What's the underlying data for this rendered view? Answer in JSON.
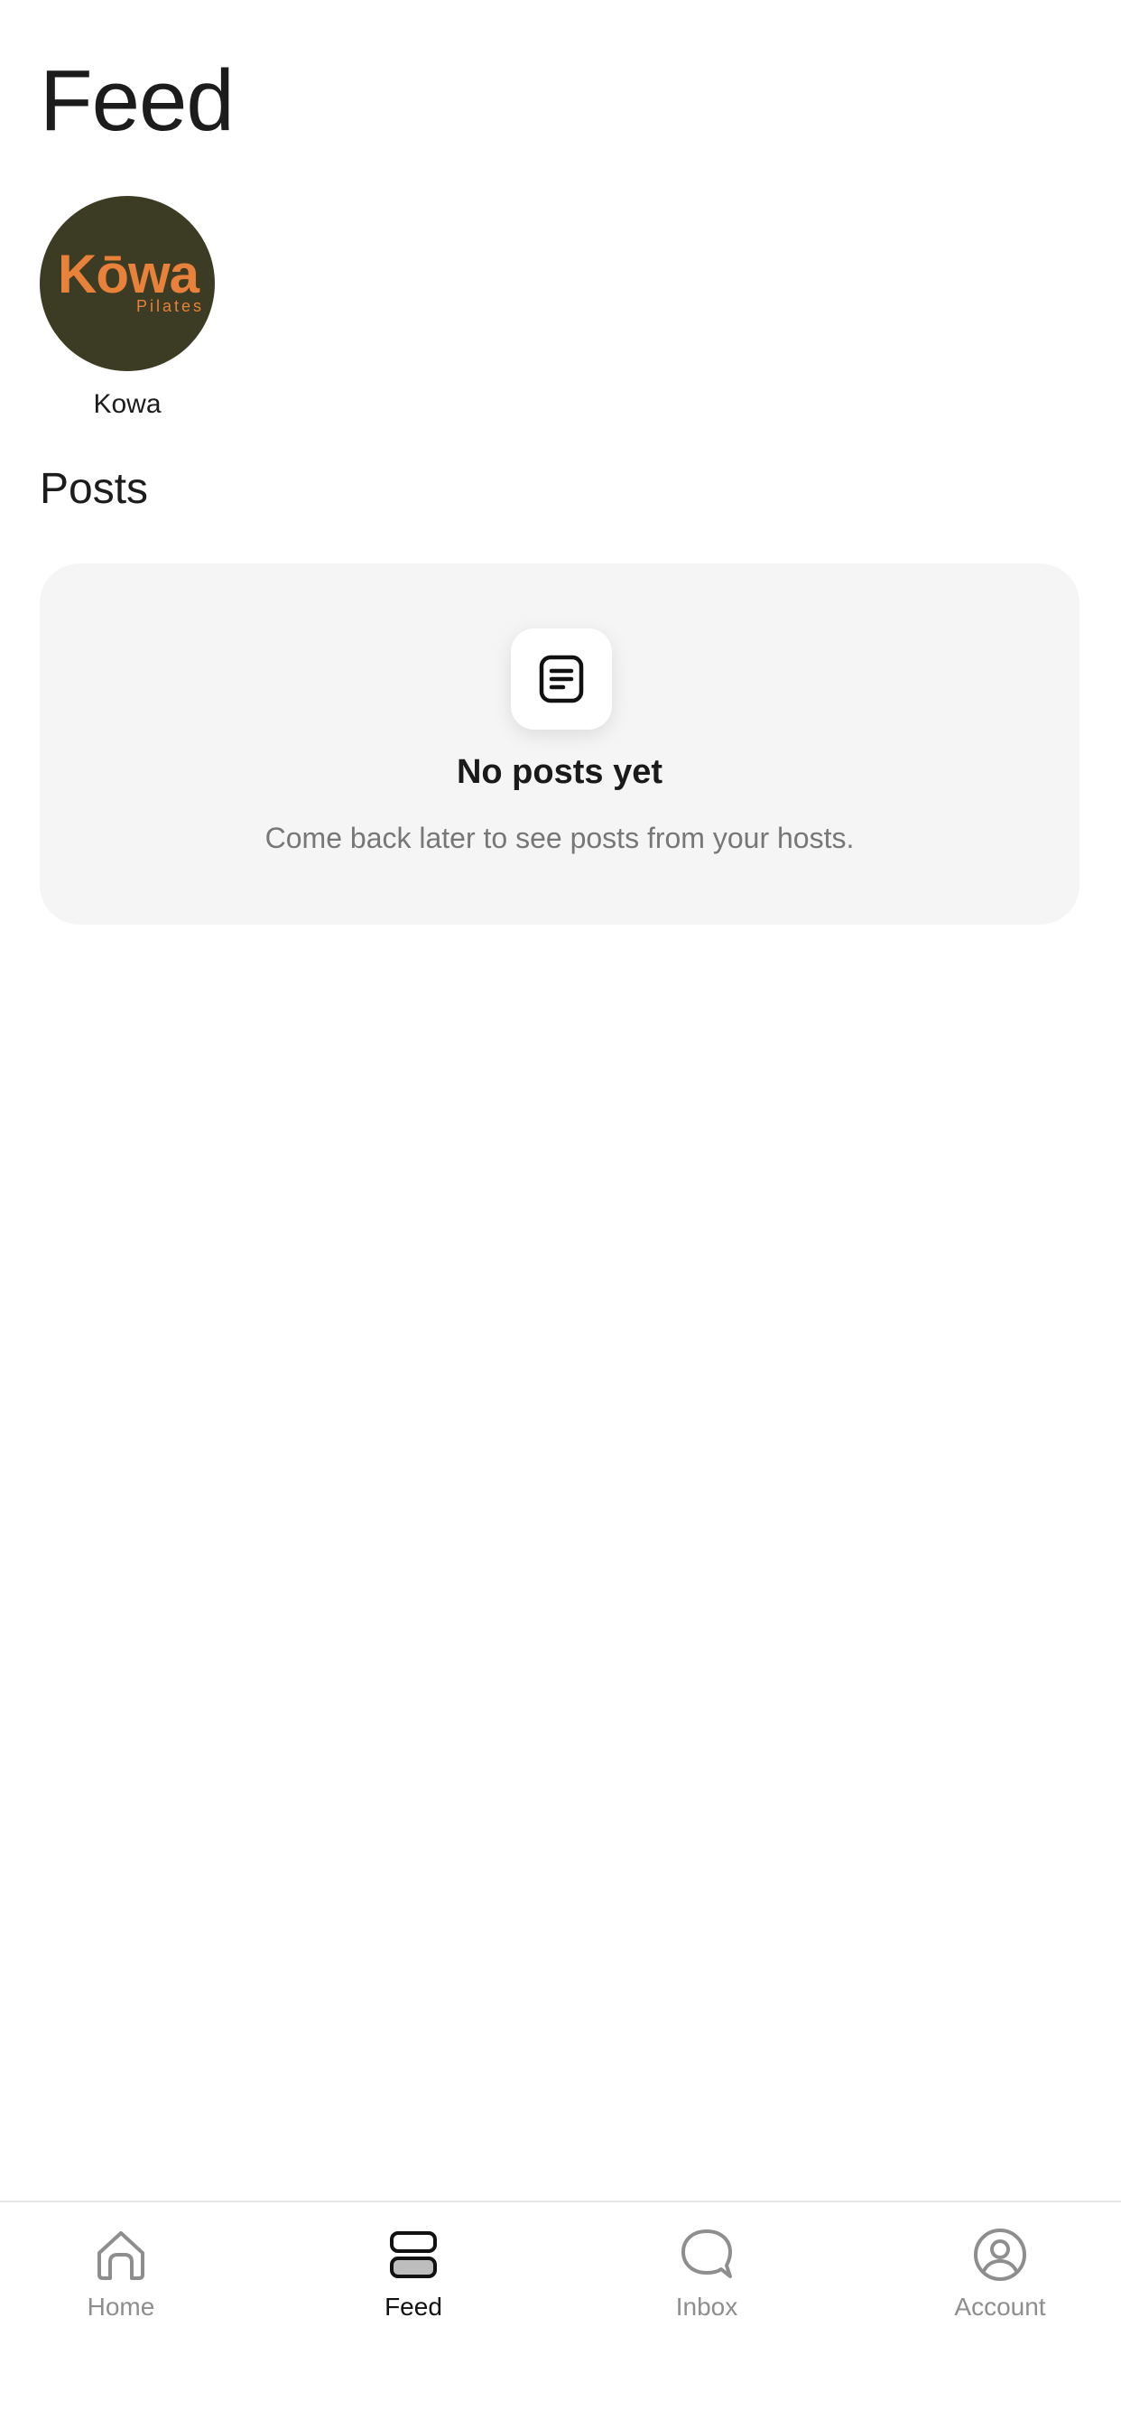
{
  "header": {
    "title": "Feed"
  },
  "hosts": [
    {
      "name": "Kowa",
      "logo_text": "Kōwa",
      "logo_subtext": "Pilates"
    }
  ],
  "posts_section": {
    "title": "Posts",
    "empty_state": {
      "icon": "document-icon",
      "title": "No posts yet",
      "subtitle": "Come back later to see posts from your hosts."
    }
  },
  "tab_bar": {
    "tabs": [
      {
        "label": "Home",
        "icon": "home-icon",
        "active": false
      },
      {
        "label": "Feed",
        "icon": "feed-icon",
        "active": true
      },
      {
        "label": "Inbox",
        "icon": "chat-bubble-icon",
        "active": false
      },
      {
        "label": "Account",
        "icon": "account-icon",
        "active": false
      }
    ]
  },
  "colors": {
    "accent": "#e8813a",
    "avatar_bg": "#3c3b23",
    "card_bg": "#f5f5f5",
    "inactive_tab": "#8e8e8e",
    "active_tab": "#111111"
  }
}
